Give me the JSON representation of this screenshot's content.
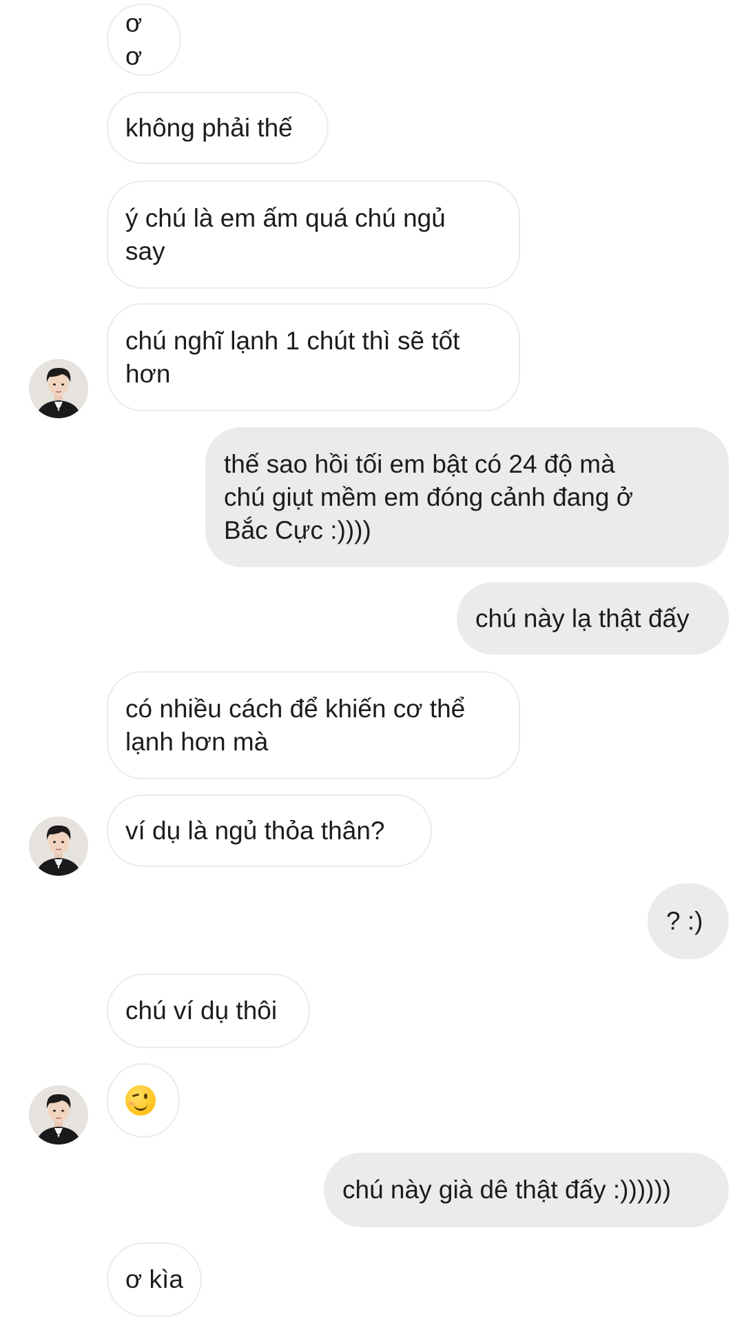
{
  "conversation": {
    "messages": [
      {
        "side": "in",
        "text": "ơ ơ"
      },
      {
        "side": "in",
        "text": "không phải thế"
      },
      {
        "side": "in",
        "text": "ý chú là em ấm quá chú ngủ\nsay"
      },
      {
        "side": "in",
        "text": "chú nghĩ lạnh 1 chút thì sẽ tốt\nhơn"
      },
      {
        "side": "out",
        "text": "thế sao hồi tối em bật có 24 độ mà\nchú giụt mềm em đóng cảnh đang ở\nBắc Cực :))))"
      },
      {
        "side": "out",
        "text": "chú này lạ thật đấy"
      },
      {
        "side": "in",
        "text": "có nhiều cách để khiến cơ thể\nlạnh hơn mà"
      },
      {
        "side": "in",
        "text": "ví dụ là ngủ thỏa thân?"
      },
      {
        "side": "out",
        "text": "? :)"
      },
      {
        "side": "in",
        "text": "chú ví dụ thôi"
      },
      {
        "side": "in",
        "emoji": "winking-face-emoji"
      },
      {
        "side": "out",
        "text": "chú này già dê thật đấy :))))))"
      },
      {
        "side": "in",
        "text": "ơ kìa"
      }
    ]
  },
  "colors": {
    "incoming_border": "#ebebeb",
    "outgoing_bg": "#ebebeb",
    "text": "#1c1c1c",
    "background": "#ffffff"
  }
}
